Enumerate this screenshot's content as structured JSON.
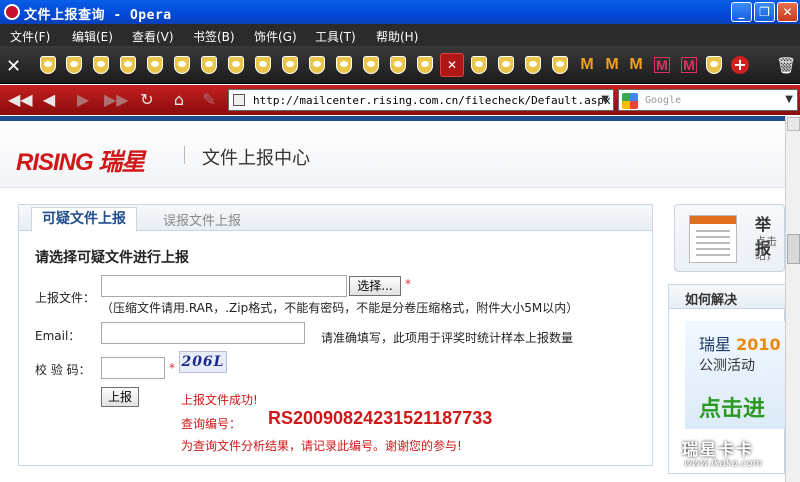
{
  "window": {
    "title": "文件上报查询 - Opera",
    "minimize": "_",
    "restore": "❐",
    "close": "✕"
  },
  "menu": [
    "文件(F)",
    "编辑(E)",
    "查看(V)",
    "书签(B)",
    "饰件(G)",
    "工具(T)",
    "帮助(H)"
  ],
  "tabs": {
    "active_label": "✕",
    "new_tab": "+"
  },
  "nav": {
    "url": "http://mailcenter.rising.com.cn/filecheck/Default.aspx",
    "search_placeholder": "Google"
  },
  "site": {
    "logo": "RISING 瑞星",
    "title": "文件上报中心"
  },
  "panel": {
    "tab_active": "可疑文件上报",
    "tab_inactive": "误报文件上报",
    "form_title": "请选择可疑文件进行上报",
    "file_label": "上报文件：",
    "browse_button": "选择...",
    "required": "*",
    "file_hint": "（压缩文件请用.RAR，.Zip格式，不能有密码，不能是分卷压缩格式，附件大小5M以内）",
    "email_label": "Email：",
    "email_hint": "请准确填写，此项用于评奖时统计样本上报数量",
    "captcha_label": "校 验 码：",
    "captcha_text": "206L",
    "submit_button": "上报",
    "success_msg": "上报文件成功!",
    "query_label": "查询编号：",
    "query_code": "RS20090824231521187733",
    "note": "为查询文件分析结果，请记录此编号。谢谢您的参与!"
  },
  "sidebar": {
    "report_title": "举报",
    "report_text_1": "点击",
    "report_text_2": "站，",
    "how_title": "如何解决",
    "banner_line1": "瑞星",
    "banner_year": "2010",
    "banner_line2": "公测活动",
    "banner_cta": "点击进"
  },
  "watermark": {
    "line1": "瑞星卡卡",
    "line2": "www.ikaka.com"
  }
}
